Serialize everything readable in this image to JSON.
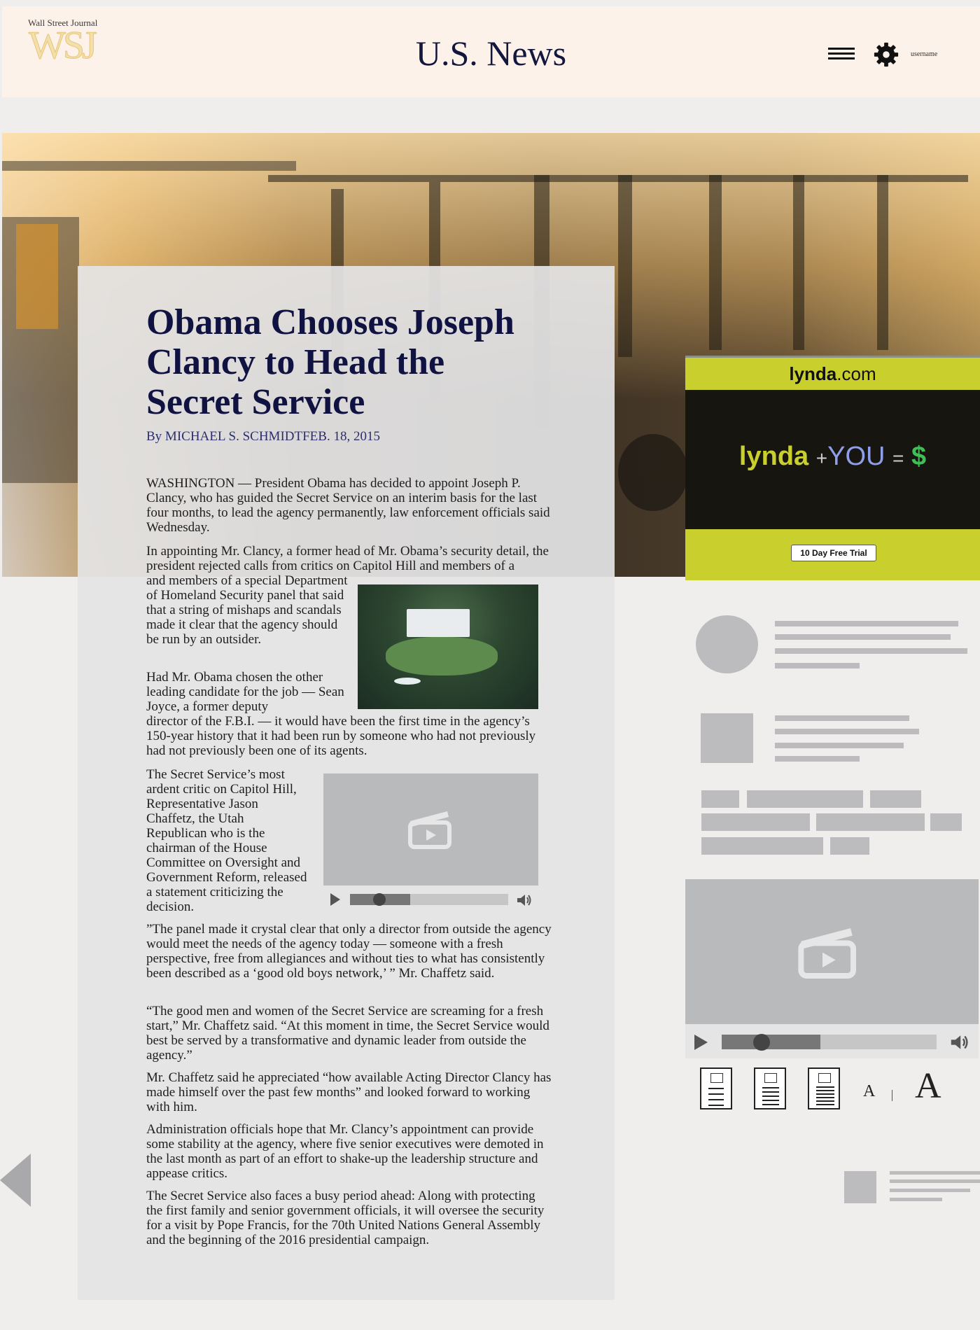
{
  "header": {
    "logo_small": "Wall Street Journal",
    "logo_big": "WSJ",
    "title": "U.S. News",
    "username": "username"
  },
  "article": {
    "headline": "Obama Chooses Joseph Clancy to Head the Secret Service",
    "byline": "By MICHAEL S. SCHMIDTFEB. 18, 2015",
    "paragraphs": [
      "WASHINGTON — President Obama has decided to appoint Joseph P. Clancy, who has guided the Secret Service on an interim basis for the last four months, to lead the agency permanently, law enforcement officials said Wednesday.",
      "In appointing Mr. Clancy, a former head of Mr. Obama’s security detail, the president rejected calls from critics on Capitol Hill and members of a special Department of Homeland Security panel that said that a string of mishaps and scandals made it clear that the agency should be run by an outsider.",
      "Had Mr. Obama chosen the other leading candidate for the job — Sean Joyce, a former deputy director of the F.B.I. — it would have been the first time in the agency’s 150-year history that it had been run by someone who had not previously been one of its agents.",
      "The Secret Service’s most ardent critic on Capitol Hill, Representative Jason Chaffetz, the Utah Republican who is the chairman of the House Committee on Oversight and Government Reform, released a statement criticizing the decision.",
      "”The panel made it crystal clear that only a director from outside the agency would meet the needs of the agency today — someone with a fresh perspective, free from allegiances and without ties to what has consistently been described as a ‘good old boys network,’ ” Mr. Chaffetz said.",
      "“The good men and women of the Secret Service are screaming for a fresh start,” Mr. Chaffetz said. “At this moment in time, the Secret Service would best be served by a transformative and dynamic leader from outside the agency.”",
      "Mr. Chaffetz said he appreciated “how available Acting Director Clancy has made himself over the past few months” and looked forward to working with him.",
      "Administration officials hope that Mr. Clancy’s appointment can provide some stability at the agency, where five senior executives were demoted in the last month as part of an effort to shake-up the leadership structure and appease critics.",
      "The Secret Service also faces a busy period ahead: Along with protecting the first family and senior government officials, it will oversee the security for a visit by Pope Francis, for the 70th United Nations General Assembly and the beginning of the 2016 presidential campaign."
    ]
  },
  "ad": {
    "brand_name": "lynda",
    "brand_domain": ".com",
    "slogan_brand": "lynda",
    "slogan_plus": "+",
    "slogan_you": "YOU",
    "slogan_eq": "=",
    "slogan_dollar": "$",
    "cta": "10 Day Free Trial",
    "colors": {
      "lime": "#c9d02e",
      "dark": "#171510",
      "blue": "#8f9ee8",
      "green": "#3fbf56"
    }
  },
  "media": {
    "inline_video_progress": 0.38,
    "sidebar_video_progress": 0.46
  },
  "controls": {
    "font_small": "A",
    "font_large": "A"
  },
  "icons": [
    "menu-icon",
    "gear-icon",
    "clapperboard-icon",
    "play-icon",
    "volume-icon",
    "document-icon",
    "prev-arrow-icon"
  ]
}
